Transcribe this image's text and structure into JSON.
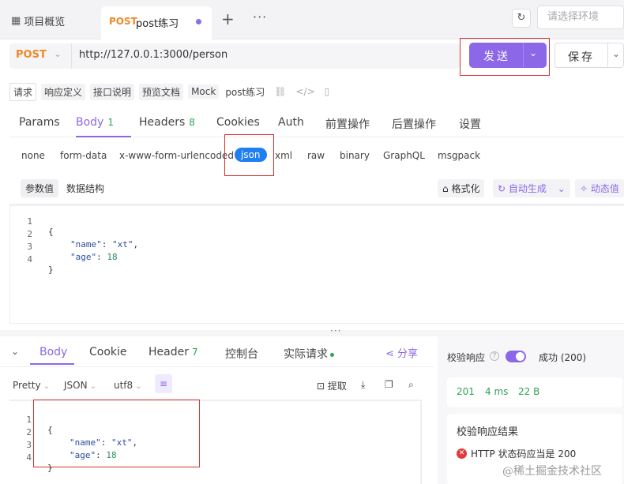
{
  "topbar": {
    "overview_tab": "项目概览",
    "active_tab": {
      "method": "POST",
      "name": "post练习"
    },
    "env_placeholder": "请选择环境"
  },
  "urlbar": {
    "method": "POST",
    "url": "http://127.0.0.1:3000/person",
    "send_label": "发送",
    "save_label": "保存"
  },
  "doc_tabs": [
    "请求",
    "响应定义",
    "接口说明",
    "预览文档",
    "Mock"
  ],
  "doc_title": "post练习",
  "param_tabs": [
    {
      "label": "Params",
      "count": ""
    },
    {
      "label": "Body",
      "count": "1"
    },
    {
      "label": "Headers",
      "count": "8"
    },
    {
      "label": "Cookies",
      "count": ""
    },
    {
      "label": "Auth",
      "count": ""
    },
    {
      "label": "前置操作",
      "count": ""
    },
    {
      "label": "后置操作",
      "count": ""
    },
    {
      "label": "设置",
      "count": ""
    }
  ],
  "body_types": [
    "none",
    "form-data",
    "x-www-form-urlencoded",
    "json",
    "xml",
    "raw",
    "binary",
    "GraphQL",
    "msgpack"
  ],
  "body_toolbar": {
    "seg_params": "参数值",
    "seg_schema": "数据结构",
    "format": "格式化",
    "auto_gen": "自动生成",
    "dynamic": "动态值"
  },
  "request_body": {
    "line_numbers": [
      "1",
      "2",
      "3",
      "4"
    ],
    "lines": [
      {
        "text": "{"
      },
      {
        "key": "\"name\"",
        "colon": ": ",
        "value": "\"xt\"",
        "tail": ","
      },
      {
        "key": "\"age\"",
        "colon": ": ",
        "value": "18",
        "tail": ""
      },
      {
        "text": "}"
      }
    ]
  },
  "response": {
    "tabs": [
      {
        "label": "Body",
        "count": ""
      },
      {
        "label": "Cookie",
        "count": ""
      },
      {
        "label": "Header",
        "count": "7"
      },
      {
        "label": "控制台",
        "count": ""
      },
      {
        "label": "实际请求",
        "count": ""
      }
    ],
    "share": "分享",
    "format_select": "Pretty",
    "type_select": "JSON",
    "encoding_select": "utf8",
    "extract": "提取",
    "line_numbers": [
      "1",
      "2",
      "3",
      "4"
    ]
  },
  "side": {
    "validate_label": "校验响应",
    "status_text": "成功 (200)",
    "status_code": "201",
    "time": "4 ms",
    "size": "22 B",
    "result_title": "校验响应结果",
    "result_error": "HTTP 状态码应当是 200"
  },
  "watermark": "@稀土掘金技术社区",
  "colors": {
    "accent": "#8c67e8",
    "post": "#f08a24",
    "json_active": "#1f7ef0",
    "success": "#2ea15a",
    "error": "#e23b3b",
    "highlight_box": "#d93030"
  }
}
